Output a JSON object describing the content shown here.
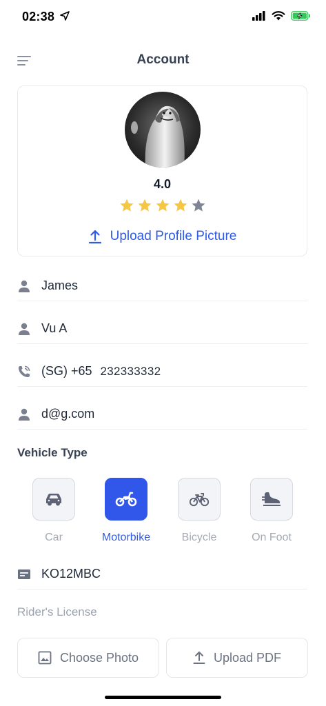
{
  "status_bar": {
    "time": "02:38"
  },
  "header": {
    "title": "Account"
  },
  "profile": {
    "rating": "4.0",
    "rating_value": 4,
    "rating_max": 5,
    "upload_label": "Upload Profile Picture"
  },
  "fields": {
    "first_name": "James",
    "last_name": "Vu A",
    "phone_prefix": "(SG) +65",
    "phone_number": "232333332",
    "email": "d@g.com"
  },
  "vehicle": {
    "section_title": "Vehicle Type",
    "options": [
      {
        "label": "Car",
        "icon": "car-icon",
        "selected": false
      },
      {
        "label": "Motorbike",
        "icon": "motorbike-icon",
        "selected": true
      },
      {
        "label": "Bicycle",
        "icon": "bicycle-icon",
        "selected": false
      },
      {
        "label": "On Foot",
        "icon": "shoe-icon",
        "selected": false
      }
    ],
    "plate": "KO12MBC"
  },
  "license": {
    "label": "Rider's License",
    "choose_photo": "Choose Photo",
    "upload_pdf": "Upload PDF"
  },
  "colors": {
    "accent": "#2f5ae8",
    "star_filled": "#f6c744",
    "star_empty": "#7f8595",
    "icon_gray": "#6b7280"
  }
}
